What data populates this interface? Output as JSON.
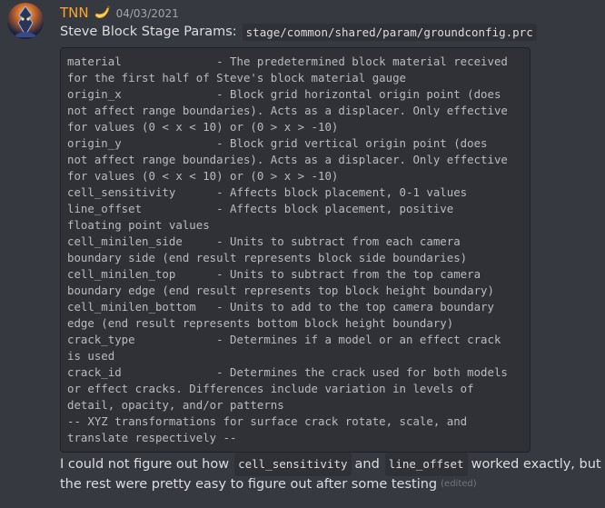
{
  "message": {
    "author": "TNN",
    "author_emoji": "banana-icon",
    "timestamp": "04/03/2021",
    "line1_prefix": "Steve Block Stage Params:",
    "line1_code": "stage/common/shared/param/groundconfig.prc",
    "code_lines": [
      "material              - The predetermined block material received",
      "for the first half of Steve's block material gauge",
      "origin_x              - Block grid horizontal origin point (does",
      "not affect range boundaries). Acts as a displacer. Only effective",
      "for values (0 < x < 10) or (0 > x > -10)",
      "origin_y              - Block grid vertical origin point (does",
      "not affect range boundaries). Acts as a displacer. Only effective",
      "for values (0 < x < 10) or (0 > x > -10)",
      "cell_sensitivity      - Affects block placement, 0-1 values",
      "line_offset           - Affects block placement, positive",
      "floating point values",
      "cell_minilen_side     - Units to subtract from each camera",
      "boundary side (end result represents block side boundaries)",
      "cell_minilen_top      - Units to subtract from the top camera",
      "boundary edge (end result represents top block height boundary)",
      "cell_minilen_bottom   - Units to add to the top camera boundary",
      "edge (end result represents bottom block height boundary)",
      "crack_type            - Determines if a model or an effect crack",
      "is used",
      "crack_id              - Determines the crack used for both models",
      "or effect cracks. Differences include variation in levels of",
      "detail, opacity, and/or patterns",
      "-- XYZ transformations for surface crack rotate, scale, and",
      "translate respectively --"
    ],
    "para": {
      "text1": "I could not figure out how",
      "code1": "cell_sensitivity",
      "text2": "and",
      "code2": "line_offset",
      "text3": "worked exactly, but",
      "line2": "the rest were pretty easy to figure out after some testing",
      "edited": "(edited)"
    }
  },
  "colors": {
    "background": "#36393f",
    "username": "#f9a62b",
    "codeblock_bg": "#2f3136",
    "code_text": "#b9bbbe",
    "body_text": "#dcddde",
    "timestamp": "#a3a6aa",
    "edited": "#72767d"
  }
}
